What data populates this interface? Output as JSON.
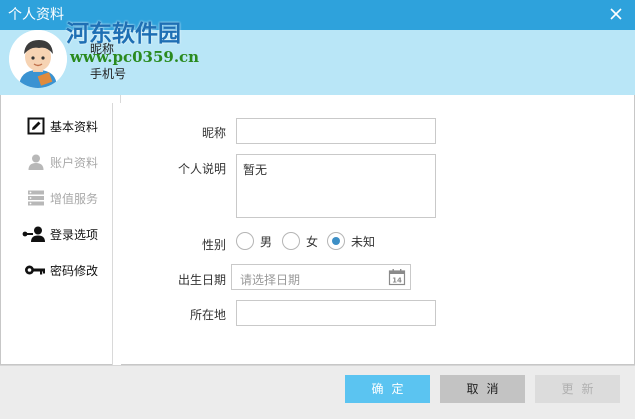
{
  "window": {
    "title": "个人资料",
    "close_icon": "close-icon"
  },
  "header": {
    "nickname_label": "昵称",
    "phone_label": "手机号",
    "avatar_icon": "user-avatar"
  },
  "watermark": {
    "title": "河东软件园",
    "url": "www.pc0359.cn"
  },
  "sidebar": {
    "items": [
      {
        "label": "基本资料",
        "icon": "edit-icon",
        "state": "active"
      },
      {
        "label": "账户资料",
        "icon": "user-icon",
        "state": "disabled"
      },
      {
        "label": "增值服务",
        "icon": "server-icon",
        "state": "disabled"
      },
      {
        "label": "登录选项",
        "icon": "login-user-icon",
        "state": "active"
      },
      {
        "label": "密码修改",
        "icon": "key-icon",
        "state": "active"
      }
    ]
  },
  "form": {
    "nickname_label": "昵称",
    "nickname_value": "",
    "intro_label": "个人说明",
    "intro_value": "暂无",
    "gender_label": "性别",
    "gender_options": [
      "男",
      "女",
      "未知"
    ],
    "gender_selected": "未知",
    "birthday_label": "出生日期",
    "birthday_placeholder": "请选择日期",
    "location_label": "所在地",
    "location_value": ""
  },
  "footer": {
    "ok_label": "确定",
    "cancel_label": "取消",
    "update_label": "更新"
  },
  "colors": {
    "titlebar": "#2ea2dc",
    "header_band": "#b9e6f7",
    "ok_button": "#5bc4f1",
    "radio_checked": "#3d8fc6"
  }
}
